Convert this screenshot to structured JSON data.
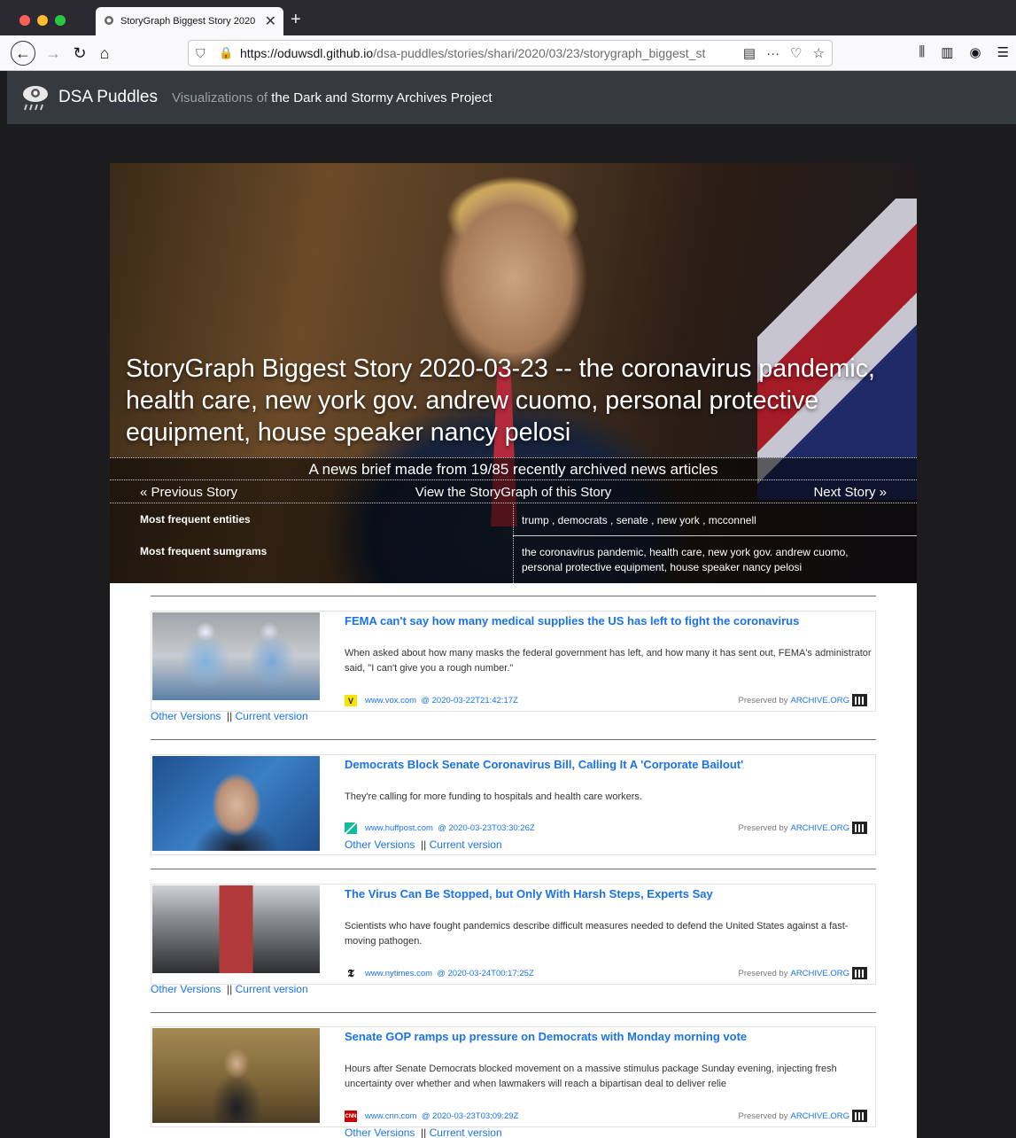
{
  "browser": {
    "tab_title": "StoryGraph Biggest Story 2020",
    "url_host": "https://oduwsdl.github.io",
    "url_path": "/dsa-puddles/stories/shari/2020/03/23/storygraph_biggest_st"
  },
  "site": {
    "brand": "DSA Puddles",
    "tagline_prefix": "Visualizations of",
    "tagline_link": "the Dark and Stormy Archives Project"
  },
  "story": {
    "title": "StoryGraph Biggest Story 2020-03-23 -- the coronavirus pandemic, health care, new york gov. andrew cuomo, personal protective equipment, house speaker nancy pelosi",
    "brief": "A news brief made from 19/85 recently archived news articles",
    "prev_label": "« Previous Story",
    "view_label": "View the StoryGraph of this Story",
    "next_label": "Next Story »",
    "entities_label": "Most frequent entities",
    "entities_value": "trump , democrats , senate , new york , mcconnell",
    "sumgrams_label": "Most frequent sumgrams",
    "sumgrams_value": "the coronavirus pandemic, health care, new york gov. andrew cuomo, personal protective equipment, house speaker nancy pelosi"
  },
  "articles": [
    {
      "title": "FEMA can't say how many medical supplies the US has left to fight the coronavirus",
      "description": "When asked about how many masks the federal government has left, and how many it has sent out, FEMA's administrator said, \"I can't give you a rough number.\"",
      "source": "www.vox.com",
      "timestamp": "@ 2020-03-22T21:42:17Z",
      "preserved_label": "Preserved by",
      "preserved_link": "ARCHIVE.ORG",
      "other_versions": "Other Versions",
      "current_version": "Current version",
      "separator": "||"
    },
    {
      "title": "Democrats Block Senate Coronavirus Bill, Calling It A 'Corporate Bailout'",
      "description": "They're calling for more funding to hospitals and health care workers.",
      "source": "www.huffpost.com",
      "timestamp": "@ 2020-03-23T03:30:26Z",
      "preserved_label": "Preserved by",
      "preserved_link": "ARCHIVE.ORG",
      "other_versions": "Other Versions",
      "current_version": "Current version",
      "separator": "||"
    },
    {
      "title": "The Virus Can Be Stopped, but Only With Harsh Steps, Experts Say",
      "description": "Scientists who have fought pandemics describe difficult measures needed to defend the United States against a fast-moving pathogen.",
      "source": "www.nytimes.com",
      "timestamp": "@ 2020-03-24T00:17:25Z",
      "preserved_label": "Preserved by",
      "preserved_link": "ARCHIVE.ORG",
      "other_versions": "Other Versions",
      "current_version": "Current version",
      "separator": "||"
    },
    {
      "title": "Senate GOP ramps up pressure on Democrats with Monday morning vote",
      "description": "Hours after Senate Democrats blocked movement on a massive stimulus package Sunday evening, injecting fresh uncertainty over whether and when lawmakers will reach a bipartisan deal to deliver relie",
      "source": "www.cnn.com",
      "timestamp": "@ 2020-03-23T03:09:29Z",
      "preserved_label": "Preserved by",
      "preserved_link": "ARCHIVE.ORG",
      "other_versions": "Other Versions",
      "current_version": "Current version",
      "separator": "||"
    }
  ],
  "icons": [
    "back-icon",
    "forward-icon",
    "reload-icon",
    "home-icon",
    "shield-icon",
    "lock-warning-icon",
    "reader-icon",
    "more-icon",
    "pocket-icon",
    "bookmark-star-icon",
    "library-icon",
    "sidebar-icon",
    "account-icon",
    "menu-icon",
    "archive-icon"
  ],
  "colors": {
    "link": "#1a73e8",
    "header_bg": "#343a40",
    "page_bg": "#1c1c1e"
  }
}
